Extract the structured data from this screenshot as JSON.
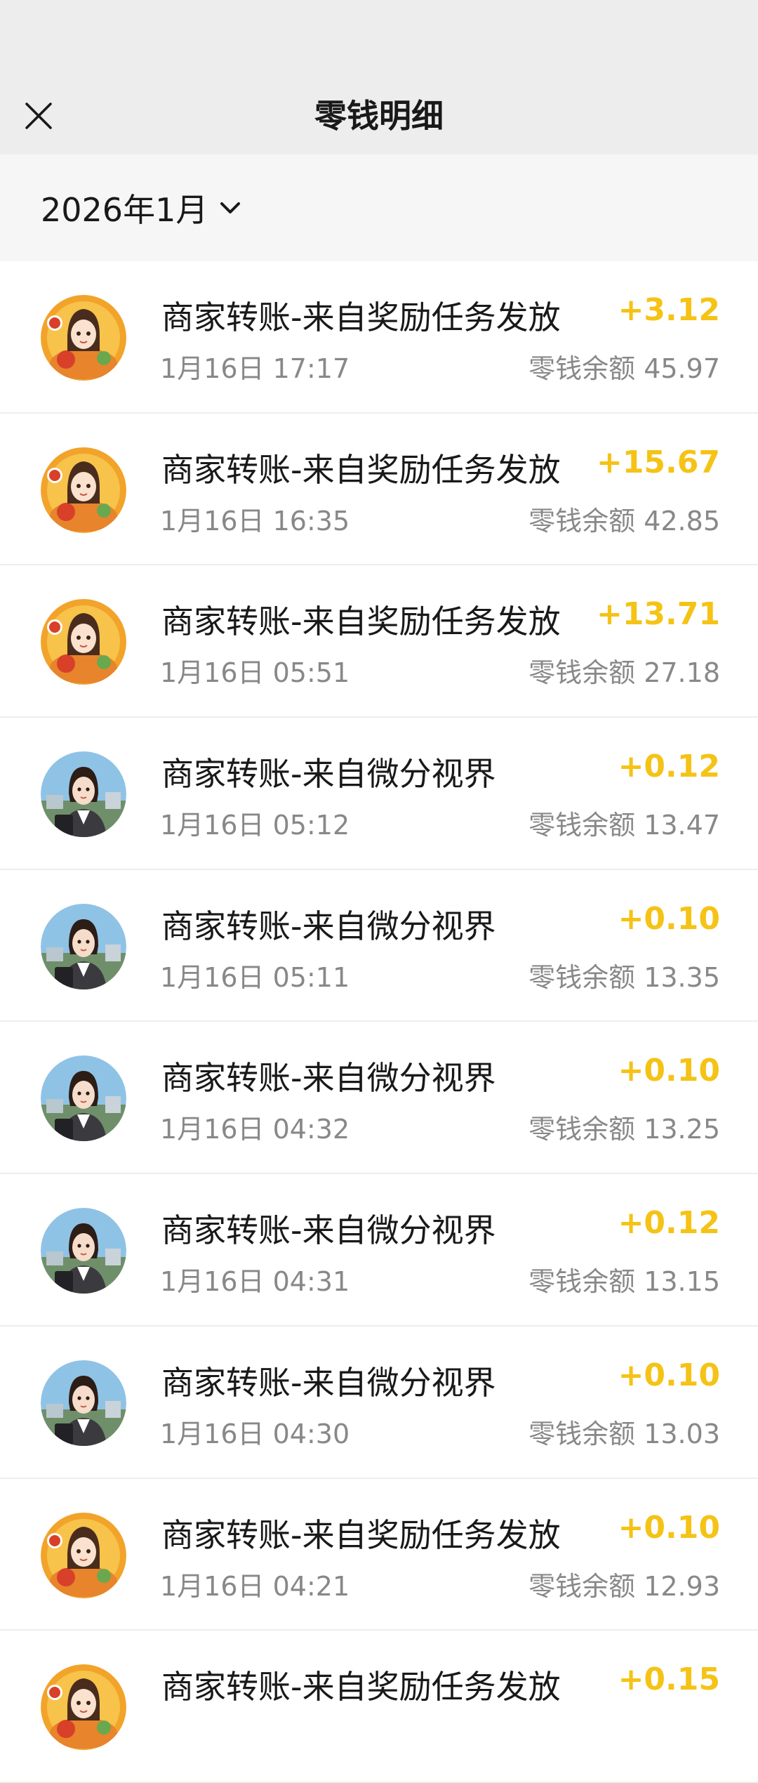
{
  "header": {
    "title": "零钱明细",
    "close_icon": "close-icon"
  },
  "filter": {
    "month": "2026年1月",
    "dropdown_icon": "chevron-down-icon"
  },
  "colors": {
    "amount": "#f5c316",
    "nav_bg": "#ededed",
    "filter_bg": "#f6f6f6"
  },
  "transactions": [
    {
      "title": "商家转账-来自奖励任务发放",
      "time": "1月16日 17:17",
      "amount": "+3.12",
      "balance": "零钱余额 45.97",
      "avatar": "reward-avatar"
    },
    {
      "title": "商家转账-来自奖励任务发放",
      "time": "1月16日 16:35",
      "amount": "+15.67",
      "balance": "零钱余额 42.85",
      "avatar": "reward-avatar"
    },
    {
      "title": "商家转账-来自奖励任务发放",
      "time": "1月16日 05:51",
      "amount": "+13.71",
      "balance": "零钱余额 27.18",
      "avatar": "reward-avatar"
    },
    {
      "title": "商家转账-来自微分视界",
      "time": "1月16日 05:12",
      "amount": "+0.12",
      "balance": "零钱余额 13.47",
      "avatar": "business-avatar"
    },
    {
      "title": "商家转账-来自微分视界",
      "time": "1月16日 05:11",
      "amount": "+0.10",
      "balance": "零钱余额 13.35",
      "avatar": "business-avatar"
    },
    {
      "title": "商家转账-来自微分视界",
      "time": "1月16日 04:32",
      "amount": "+0.10",
      "balance": "零钱余额 13.25",
      "avatar": "business-avatar"
    },
    {
      "title": "商家转账-来自微分视界",
      "time": "1月16日 04:31",
      "amount": "+0.12",
      "balance": "零钱余额 13.15",
      "avatar": "business-avatar"
    },
    {
      "title": "商家转账-来自微分视界",
      "time": "1月16日 04:30",
      "amount": "+0.10",
      "balance": "零钱余额 13.03",
      "avatar": "business-avatar"
    },
    {
      "title": "商家转账-来自奖励任务发放",
      "time": "1月16日 04:21",
      "amount": "+0.10",
      "balance": "零钱余额 12.93",
      "avatar": "reward-avatar"
    },
    {
      "title": "商家转账-来自奖励任务发放",
      "time": "",
      "amount": "+0.15",
      "balance": "",
      "avatar": "reward-avatar"
    }
  ]
}
